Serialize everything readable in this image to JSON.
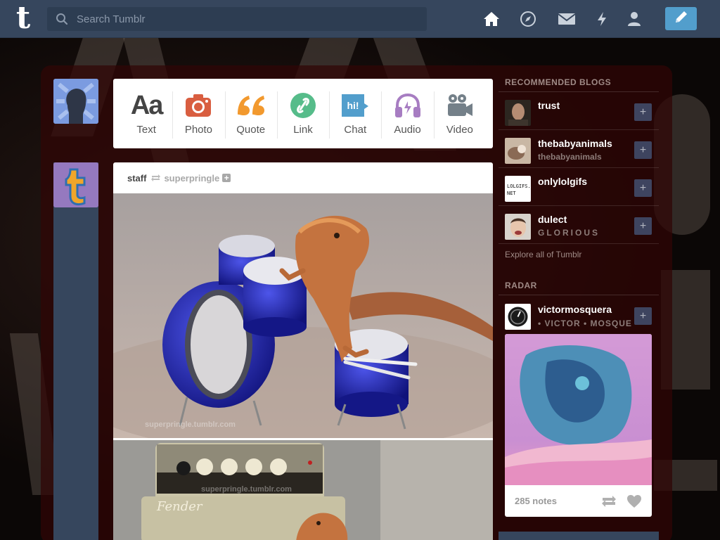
{
  "topbar": {
    "logo": "t",
    "search_placeholder": "Search Tumblr",
    "icons": [
      "home-icon",
      "explore-compass-icon",
      "inbox-envelope-icon",
      "activity-lightning-icon",
      "account-person-icon"
    ],
    "compose_icon": "pencil-icon",
    "accent": "#529ecc",
    "bar_color": "#36465d"
  },
  "post_types": [
    {
      "label": "Text",
      "icon": "text-aa-icon",
      "color": "#444444",
      "glyph": "Aa"
    },
    {
      "label": "Photo",
      "icon": "camera-icon",
      "color": "#d95e40"
    },
    {
      "label": "Quote",
      "icon": "quote-icon",
      "color": "#f2992e"
    },
    {
      "label": "Link",
      "icon": "link-icon",
      "color": "#56bc8a"
    },
    {
      "label": "Chat",
      "icon": "chat-bubble-icon",
      "color": "#529ecc",
      "glyph": "hi!"
    },
    {
      "label": "Audio",
      "icon": "headphones-icon",
      "color": "#a77dc2"
    },
    {
      "label": "Video",
      "icon": "video-camera-icon",
      "color": "#748089"
    }
  ],
  "post": {
    "author": "staff",
    "reblogged_from": "superpringle",
    "follow_glyph": "+",
    "watermark": "superpringle.tumblr.com",
    "amp_brand": "Fender"
  },
  "sidebar": {
    "recommended_heading": "RECOMMENDED BLOGS",
    "blogs": [
      {
        "name": "trust",
        "subtitle": ""
      },
      {
        "name": "thebabyanimals",
        "subtitle": "thebabyanimals"
      },
      {
        "name": "onlylolgifs",
        "subtitle": "",
        "avatar_text": "LOLGIFS.NET"
      },
      {
        "name": "dulect",
        "subtitle": "GLORIOUS"
      }
    ],
    "explore_link": "Explore all of Tumblr",
    "follow_glyph": "+",
    "radar_heading": "RADAR",
    "radar": {
      "blog_name": "victormosquera",
      "blog_subtitle": "• VICTOR • MOSQUE",
      "notes": "285 notes"
    }
  }
}
